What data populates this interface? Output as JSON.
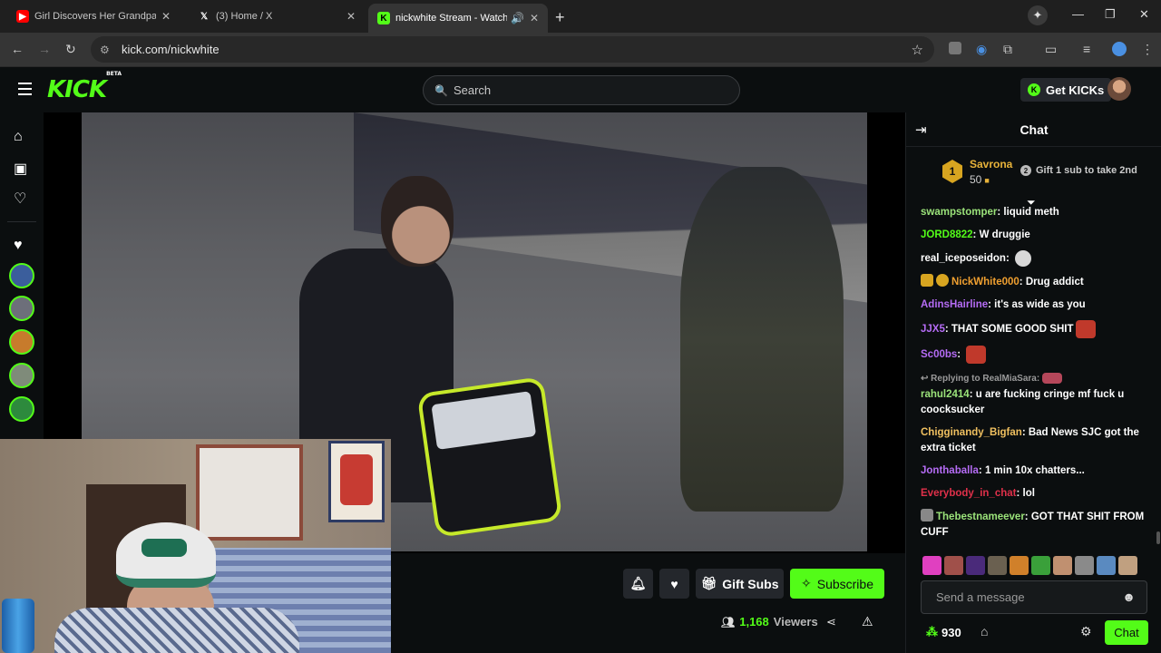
{
  "browser": {
    "tabs": [
      {
        "title": "Girl Discovers Her Grandpa Is A",
        "icon": "youtube-icon"
      },
      {
        "title": "(3) Home / X",
        "icon": "x-icon"
      },
      {
        "title": "nickwhite Stream - Watch L",
        "icon": "kick-icon"
      }
    ],
    "url": "kick.com/nickwhite"
  },
  "header": {
    "logo": "KICK",
    "logo_tag": "BETA",
    "search_placeholder": "Search",
    "get_kicks_label": "Get KICKs"
  },
  "stream": {
    "gift_subs_label": "Gift Subs",
    "subscribe_label": "Subscribe",
    "viewer_count": "1,168",
    "viewers_label": "Viewers"
  },
  "chat": {
    "title": "Chat",
    "pinned": {
      "rank": "1",
      "name": "Savrona",
      "amount": "50",
      "gift_text": "Gift 1 sub to take 2nd"
    },
    "messages": [
      {
        "user": "swampstomper",
        "color": "#9be37a",
        "text": "liquid meth"
      },
      {
        "user": "JORD8822",
        "color": "#53fc18",
        "text": "W druggie"
      },
      {
        "user": "real_iceposeidon",
        "color": "#ffffff",
        "text": "",
        "emote": "#d8d8d8"
      },
      {
        "user": "NickWhite000",
        "color": "#f0a030",
        "text": "Drug addict",
        "badges": true
      },
      {
        "user": "AdinsHairline",
        "color": "#b56cf5",
        "text": "it's as wide as you"
      },
      {
        "user": "JJX5",
        "color": "#b56cf5",
        "text": "THAT SOME GOOD SHIT",
        "emote": "#c0392b"
      },
      {
        "user": "Sc00bs",
        "color": "#b56cf5",
        "text": "",
        "emote": "#c0392b"
      },
      {
        "user": "rahul2414",
        "color": "#9be37a",
        "text": "u are fucking cringe mf fuck u coocksucker",
        "reply": "Replying to RealMiaSara:"
      },
      {
        "user": "Chigginandy_Bigfan",
        "color": "#f0c060",
        "text": "Bad News SJC got the extra ticket"
      },
      {
        "user": "Jonthaballa",
        "color": "#b56cf5",
        "text": "1 min 10x chatters..."
      },
      {
        "user": "Everybody_in_chat",
        "color": "#e0304a",
        "text": "lol"
      },
      {
        "user": "Thebestnameever",
        "color": "#9be37a",
        "text": "GOT THAT SHIT FROM CUFF"
      }
    ],
    "input_placeholder": "Send a message",
    "kicks_balance": "930",
    "send_label": "Chat"
  }
}
